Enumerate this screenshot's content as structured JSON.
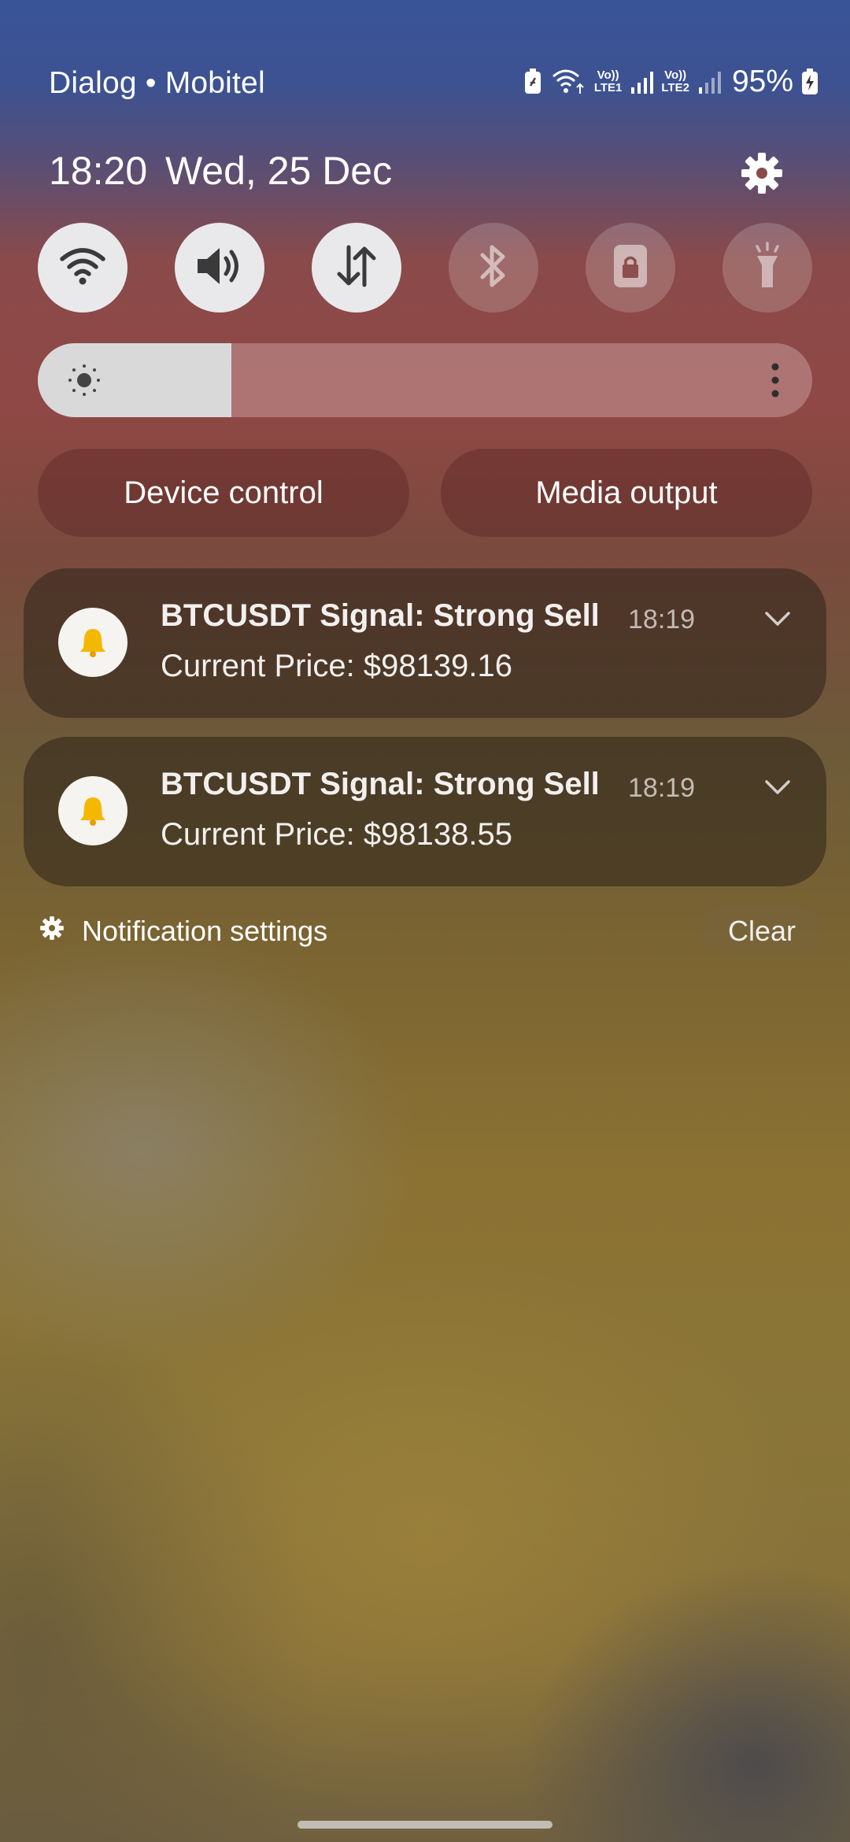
{
  "status_bar": {
    "carrier": "Dialog • Mobitel",
    "sim1_label_top": "Vo))",
    "sim1_label_bottom": "LTE1",
    "sim2_label_top": "Vo))",
    "sim2_label_bottom": "LTE2",
    "battery": "95%"
  },
  "header": {
    "time": "18:20",
    "date": "Wed, 25 Dec"
  },
  "quick_tiles": [
    {
      "name": "wifi",
      "icon": "wifi-icon",
      "active": true
    },
    {
      "name": "sound",
      "icon": "speaker-icon",
      "active": true
    },
    {
      "name": "mobile-data",
      "icon": "data-arrows-icon",
      "active": true
    },
    {
      "name": "bluetooth",
      "icon": "bluetooth-icon",
      "active": false
    },
    {
      "name": "rotation-lock",
      "icon": "rotation-lock-icon",
      "active": false
    },
    {
      "name": "flashlight",
      "icon": "flashlight-icon",
      "active": false
    }
  ],
  "brightness": {
    "level": 0.25
  },
  "buttons": {
    "device_control": "Device control",
    "media_output": "Media output"
  },
  "notifications": [
    {
      "title": "BTCUSDT Signal: Strong Sell",
      "time": "18:19",
      "body": "Current Price: $98139.16",
      "icon": "bell-icon"
    },
    {
      "title": "BTCUSDT Signal: Strong Sell",
      "time": "18:19",
      "body": "Current Price: $98138.55",
      "icon": "bell-icon"
    }
  ],
  "footer": {
    "notification_settings": "Notification settings",
    "clear": "Clear"
  },
  "colors": {
    "tile_on": "#e9e9ec",
    "bell": "#f5b800"
  }
}
